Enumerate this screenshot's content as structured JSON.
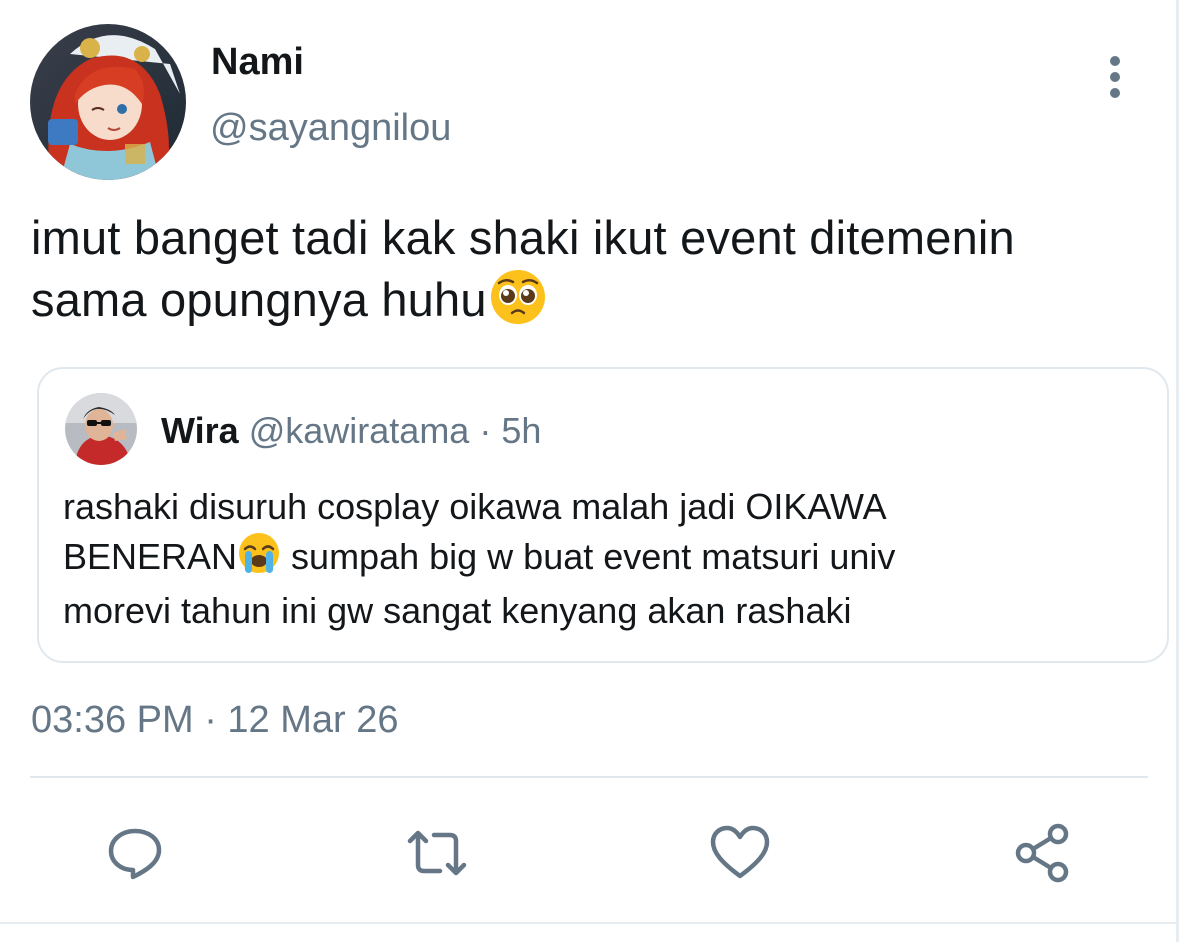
{
  "tweet": {
    "author": {
      "display_name": "Nami",
      "handle": "@sayangnilou"
    },
    "text_lines": [
      "imut banget tadi kak shaki ikut event ditemenin",
      "sama opungnya huhu"
    ],
    "text_emoji": "pleading-face",
    "timestamp": "03:36 PM · 12 Mar 26"
  },
  "quote": {
    "display_name": "Wira",
    "meta": "@kawiratama · 5h",
    "text_line1": "rashaki disuruh cosplay oikawa malah jadi OIKAWA",
    "text_line2_a": "BENERAN",
    "text_line2_b": " sumpah big w buat event matsuri univ",
    "text_line3": "morevi tahun ini gw sangat kenyang akan rashaki",
    "emoji": "loudly-crying-face"
  },
  "actions": [
    "reply-icon",
    "retweet-icon",
    "like-icon",
    "share-icon"
  ],
  "colors": {
    "text_primary": "#14171a",
    "text_secondary": "#657786",
    "border": "#e1e8ed"
  }
}
